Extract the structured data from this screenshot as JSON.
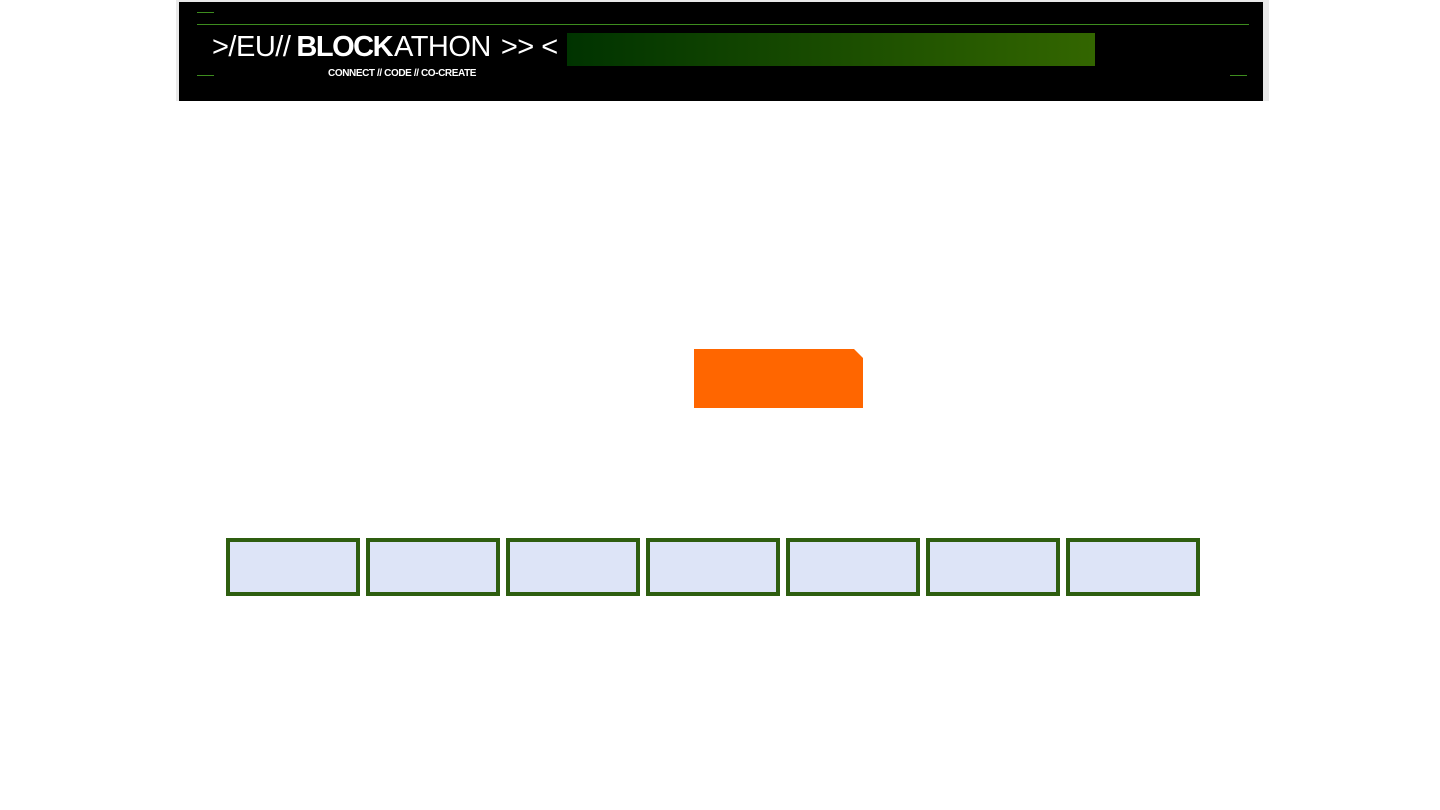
{
  "header": {
    "logo": {
      "part1": ">/EU//",
      "part2": "BLOCK",
      "part3": "ATHON",
      "part4": ">> <",
      "tagline": "CONNECT // CODE // CO-CREATE"
    }
  },
  "colors": {
    "banner_bg": "#000000",
    "accent_green": "#3d8c1e",
    "gradient_start": "#003300",
    "gradient_end": "#336600",
    "cta_orange": "#ff6600",
    "tile_fill": "#dde4f7",
    "tile_border": "#2e5e10"
  },
  "cta": {
    "label": ""
  },
  "tiles": [
    {
      "label": ""
    },
    {
      "label": ""
    },
    {
      "label": ""
    },
    {
      "label": ""
    },
    {
      "label": ""
    },
    {
      "label": ""
    },
    {
      "label": ""
    }
  ]
}
